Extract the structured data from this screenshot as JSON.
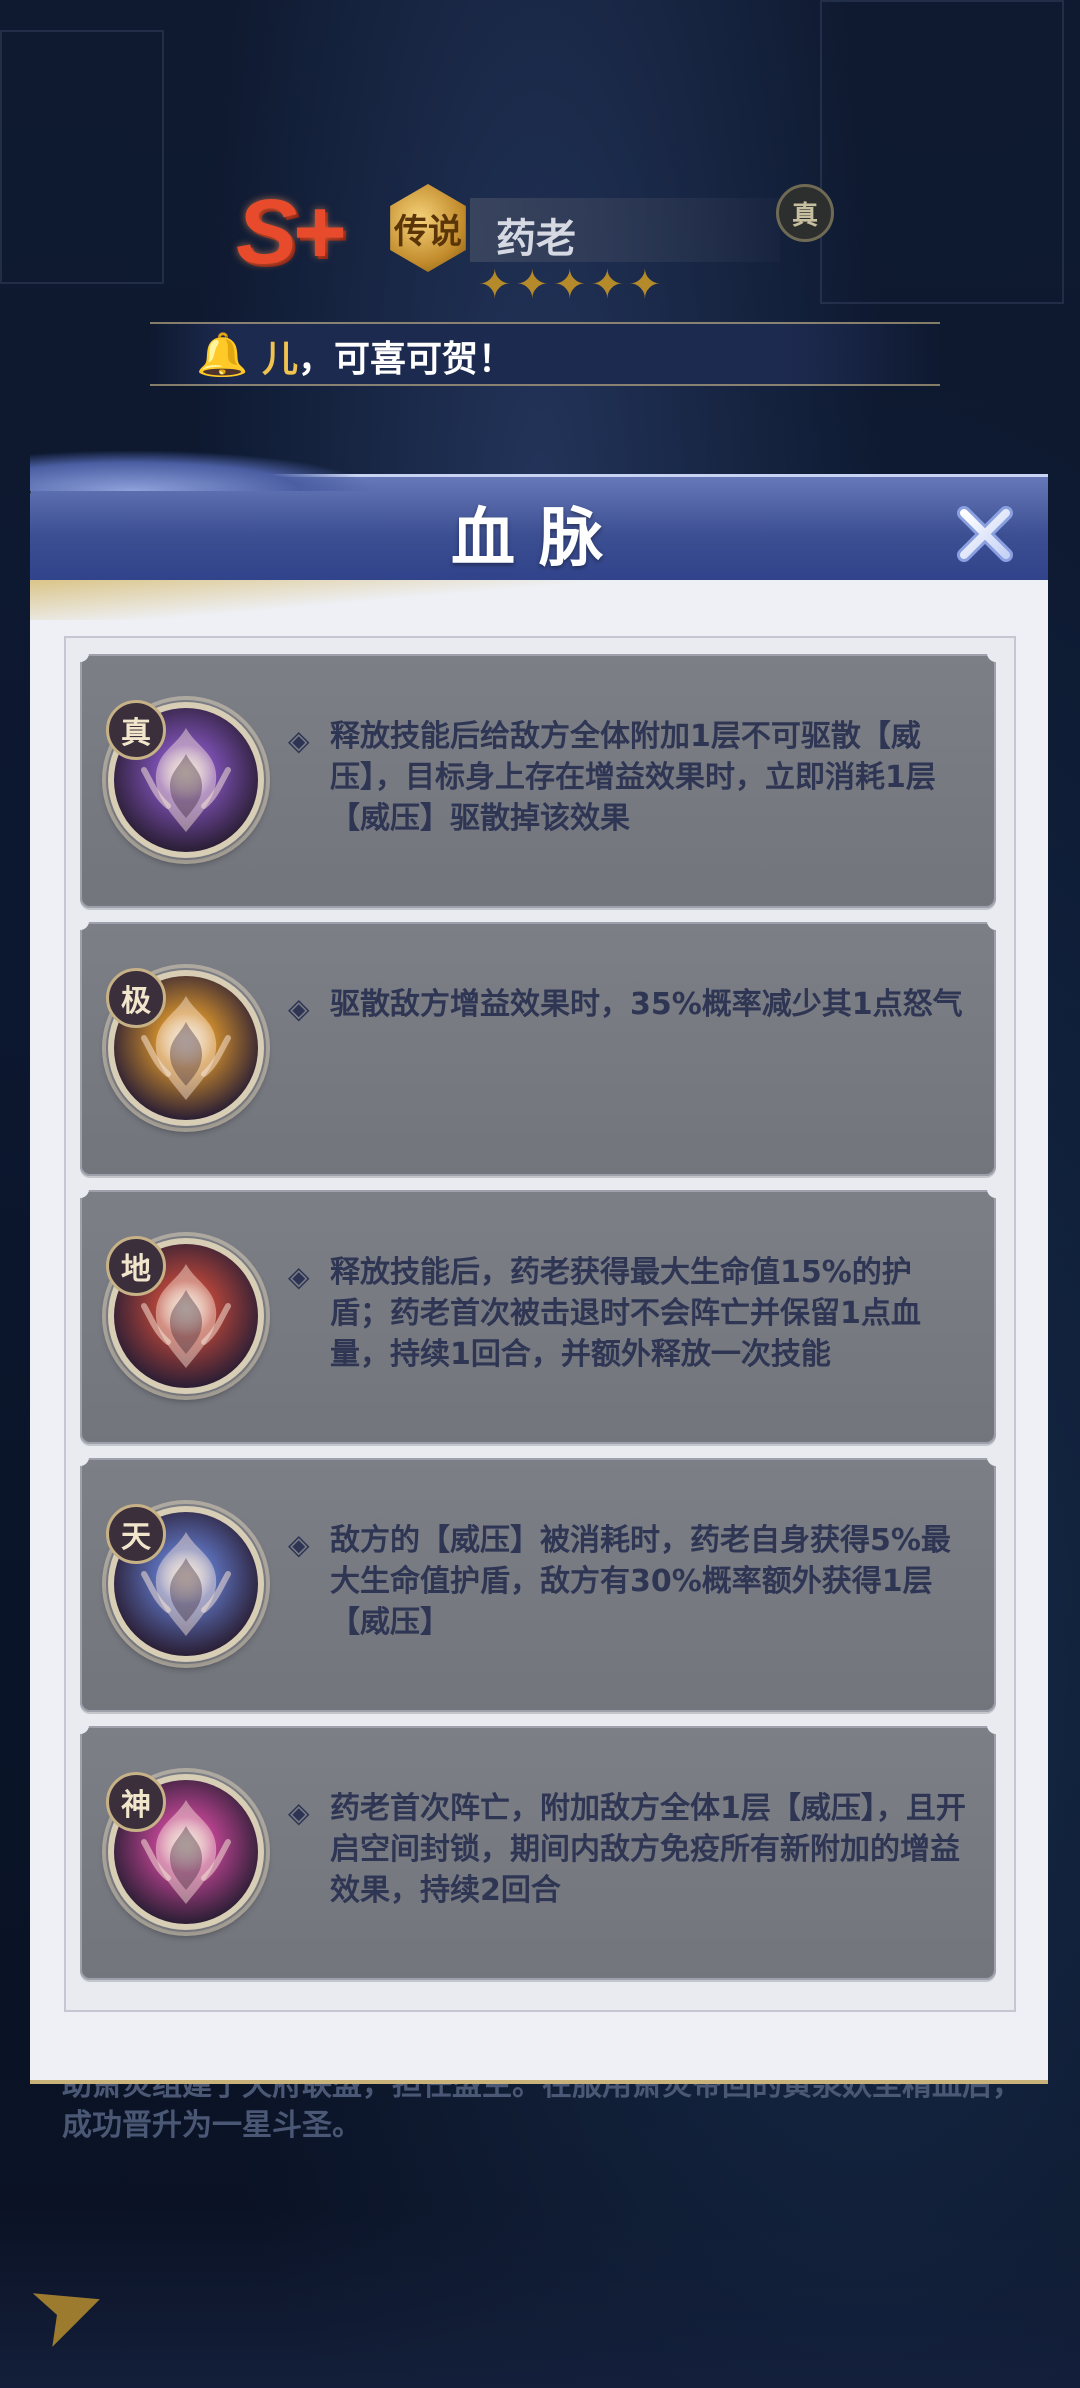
{
  "background": {
    "rank": "S+",
    "legend_badge": "传说",
    "hero_name": "药老",
    "true_tag": "真",
    "stars": "✦✦✦✦✦",
    "congrats": {
      "highlight": "儿",
      "rest": "，可喜可贺！"
    },
    "bio": "助萧炎组建了天府联盟，担任盟主。在服用萧炎帝回的黄泉妖圣精血后，成功晋升为一星斗圣。"
  },
  "dialog": {
    "title": "血脉",
    "close_icon": "close-icon",
    "bullet": "◈",
    "items": [
      {
        "tier": "真",
        "icon": "purple-bloodline-icon",
        "color": "#7a4fb0",
        "text": "释放技能后给敌方全体附加1层不可驱散【威压】，目标身上存在增益效果时，立即消耗1层【威压】驱散掉该效果"
      },
      {
        "tier": "极",
        "icon": "gold-bloodline-icon",
        "color": "#c98a2e",
        "text": "驱散敌方增益效果时，35%概率减少其1点怒气"
      },
      {
        "tier": "地",
        "icon": "red-bloodline-icon",
        "color": "#b1443a",
        "text": "释放技能后，药老获得最大生命值15%的护盾；药老首次被击退时不会阵亡并保留1点血量，持续1回合，并额外释放一次技能"
      },
      {
        "tier": "天",
        "icon": "blue-bloodline-icon",
        "color": "#5b6fb8",
        "text": "敌方的【威压】被消耗时，药老自身获得5%最大生命值护盾，敌方有30%概率额外获得1层【威压】"
      },
      {
        "tier": "神",
        "icon": "magenta-bloodline-icon",
        "color": "#b8438f",
        "text": "药老首次阵亡，附加敌方全体1层【威压】，且开启空间封锁，期间内敌方免疫所有新附加的增益效果，持续2回合"
      }
    ]
  }
}
